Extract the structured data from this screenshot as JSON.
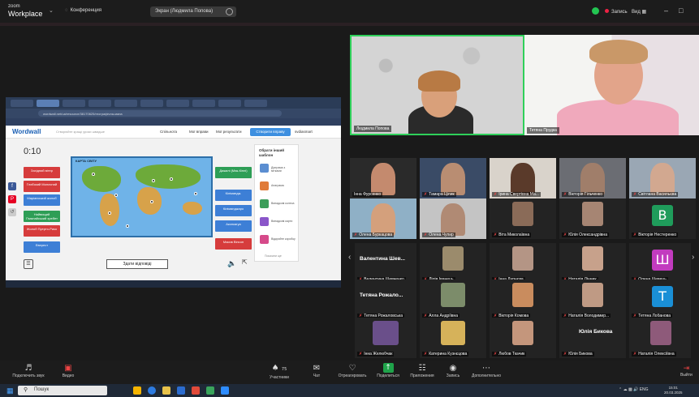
{
  "zoom": {
    "logo_line1": "zoom",
    "logo_line2": "Workplace",
    "conference_label": "Конференция",
    "share_indicator": "Экран (Людмила Попова)",
    "recording_label": "Запись",
    "view_label": "Вид",
    "colors": {
      "accent_green": "#2fd05a",
      "record_red": "#e22244",
      "bar_bg": "#1c1c1c"
    }
  },
  "shared_screen": {
    "url": "wordwall.net/ua/resource/38170625/географічна-мапа",
    "site": {
      "logo": "Wordwall",
      "tagline": "Створюйте кращі уроки швидше",
      "nav": [
        "Спільнота",
        "Мої вправи",
        "Мої результати"
      ],
      "create_button": "Створити вправу",
      "user": "svdiasmart"
    },
    "timer": "0:10",
    "map_title": "КАРТА СВІТУ",
    "left_labels": [
      "Західний вітер",
      "Глибокий Молочний",
      "Маріанський жолоб",
      "Жолоб Пуерто-Рико",
      "Еверест"
    ],
    "left_labels_extra": "Найвищий Гімалайський хребет",
    "right_labels": [
      "Дажилі (Мак-Кінлі)",
      "Кілімандж.",
      "Кіліманджаро",
      "Аконкагуа",
      "Масив Вінсон"
    ],
    "answers_button": "Здати відповіді",
    "sidebar_title": "Обрати інший шаблон",
    "templates": [
      "Діаграма з мітками",
      "Анаграма",
      "Випадкові колеса",
      "Випадкові карти",
      "Відкрийте коробку"
    ],
    "sidebar_more": "Показати ще"
  },
  "speakers": [
    {
      "name": "Людмила Попова"
    },
    {
      "name": "Тетяна Прудка"
    }
  ],
  "gallery": [
    {
      "name": "Інна Фурсенко",
      "muted": false
    },
    {
      "name": "Тамара Цілик",
      "muted": true
    },
    {
      "name": "Ірина Свертівна Ма...",
      "muted": true
    },
    {
      "name": "Вікторія Гільченко",
      "muted": true
    },
    {
      "name": "Світлана Васильєва",
      "muted": true
    },
    {
      "name": "Олена Буркацова",
      "muted": true
    },
    {
      "name": "Олена Чупир",
      "muted": true
    },
    {
      "name": "Віта Миколаївна",
      "muted": true
    },
    {
      "name": "Юлія Олександрівна",
      "muted": true
    },
    {
      "name": "Вікторія Нестеренко",
      "muted": true,
      "avatar_letter": "В",
      "avatar_color": "#1f9c5b"
    },
    {
      "name": "Валентина Шевченко",
      "muted": true,
      "top_name": "Валентина Шев..."
    },
    {
      "name": "Лілія Іванець",
      "muted": true
    },
    {
      "name": "Інна Дурнєва",
      "muted": true
    },
    {
      "name": "Наталія Лінник",
      "muted": true
    },
    {
      "name": "Олена Шевець",
      "muted": true,
      "avatar_letter": "Ш",
      "avatar_color": "#c23bbf"
    },
    {
      "name": "Тетяна Рожаловська",
      "muted": true,
      "top_name": "Тетяна Рожало..."
    },
    {
      "name": "Алла Андріївна",
      "muted": true
    },
    {
      "name": "Вікторія Комова",
      "muted": true
    },
    {
      "name": "Наталія Володимир...",
      "muted": true
    },
    {
      "name": "Тетяна Лобанова",
      "muted": true,
      "avatar_letter": "Т",
      "avatar_color": "#1a8fd6"
    },
    {
      "name": "Інна Желюбчак",
      "muted": true
    },
    {
      "name": "Катерина Кузнєцова",
      "muted": true
    },
    {
      "name": "Любов Ткачик",
      "muted": true
    },
    {
      "name": "Юлія Бикова",
      "muted": true,
      "top_name": "Юлія Бикова"
    },
    {
      "name": "Наталія Олексіївна",
      "muted": true
    }
  ],
  "toolbar": {
    "mic_label": "Подключить звук",
    "video_label": "Видео",
    "participants_label": "Участники",
    "participants_count": "75",
    "chat_label": "Чат",
    "react_label": "Отреагировать",
    "share_label": "Поделиться",
    "apps_label": "Приложения",
    "record_label": "Запись",
    "more_label": "Дополнительно",
    "leave_label": "Выйти"
  },
  "windows": {
    "search_placeholder": "Пошук",
    "lang": "ENG",
    "time": "15:01",
    "date": "20.03.2025"
  }
}
